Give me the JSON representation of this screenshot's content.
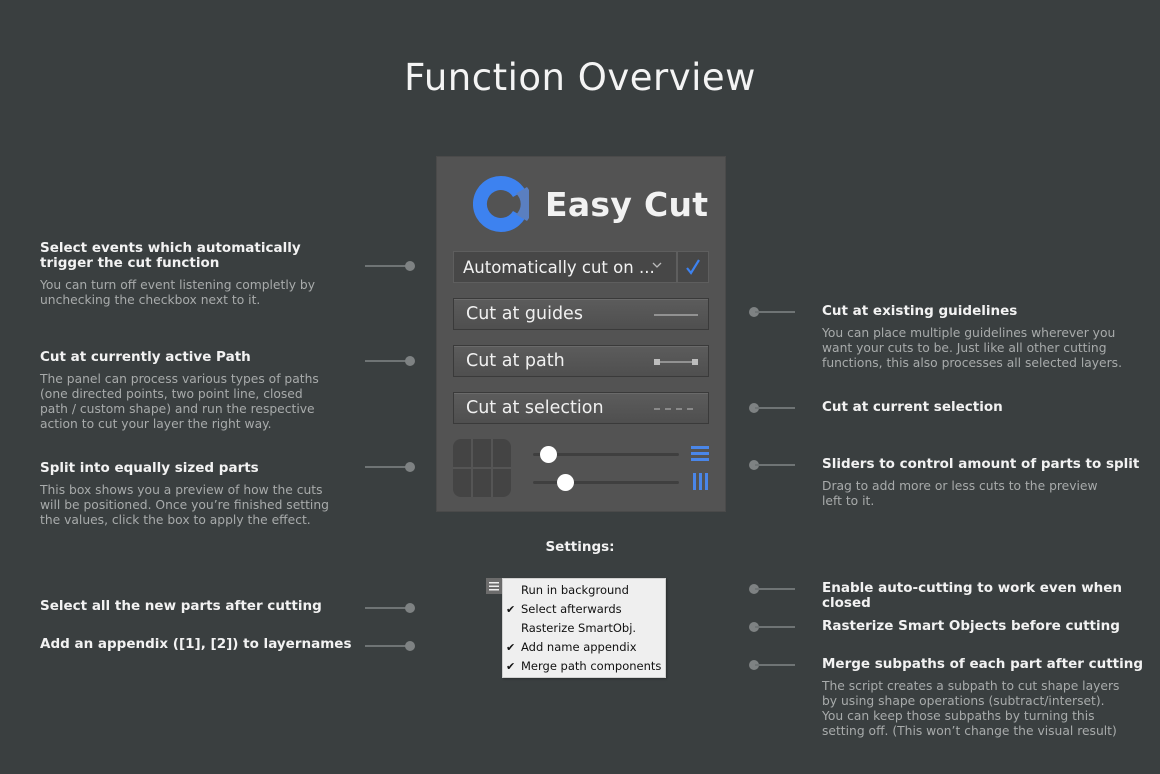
{
  "page": {
    "title": "Function Overview",
    "background": "#3a3f40"
  },
  "panel": {
    "app_name": "Easy Cut",
    "accent_color": "#3d82f0",
    "logo_icon": "c-logo-icon",
    "dropdown": {
      "value": "Automatically cut on ...",
      "icon": "chevron-down-icon"
    },
    "auto_cut_enabled": true,
    "buttons": [
      {
        "label": "Cut at guides",
        "icon": "guide-line-icon"
      },
      {
        "label": "Cut at path",
        "icon": "path-line-icon"
      },
      {
        "label": "Cut at selection",
        "icon": "dashed-line-icon"
      }
    ],
    "preview": {
      "rows": 2,
      "columns": 3
    },
    "sliders": [
      {
        "name": "rows",
        "value_fraction": 0.1,
        "icon": "horizontal-lines-icon"
      },
      {
        "name": "columns",
        "value_fraction": 0.22,
        "icon": "vertical-lines-icon"
      }
    ]
  },
  "settings": {
    "label": "Settings:",
    "menu_icon": "hamburger-menu-icon",
    "items": [
      {
        "label": "Run in background",
        "checked": false
      },
      {
        "label": "Select afterwards",
        "checked": true
      },
      {
        "label": "Rasterize SmartObj.",
        "checked": false
      },
      {
        "label": "Add name appendix",
        "checked": true
      },
      {
        "label": "Merge path components",
        "checked": true
      }
    ]
  },
  "callouts_left": [
    {
      "heading": "Select events which automatically\ntrigger the cut function",
      "description": "You can turn off event listening completly by\nunchecking the checkbox next to it."
    },
    {
      "heading": "Cut at currently active Path",
      "description": "The panel can process various types of paths\n(one directed points, two point line, closed\npath / custom shape) and run the respective\naction to cut your layer the right way."
    },
    {
      "heading": "Split into equally sized parts",
      "description": "This box shows you a preview of how the cuts\nwill be positioned. Once you’re finished setting\nthe values, click the box to apply the effect."
    },
    {
      "heading": "Select all the new parts after cutting",
      "description": ""
    },
    {
      "heading": "Add an appendix ([1], [2]) to layernames",
      "description": ""
    }
  ],
  "callouts_right": [
    {
      "heading": "Cut at existing guidelines",
      "description": "You can place multiple guidelines wherever you\nwant your cuts to be. Just like all other cutting\nfunctions, this also processes all selected layers."
    },
    {
      "heading": "Cut at current selection",
      "description": ""
    },
    {
      "heading": "Sliders to control amount of parts to split",
      "description": "Drag to add more or less cuts to the preview\nleft to it."
    },
    {
      "heading": "Enable auto-cutting to work even when closed",
      "description": ""
    },
    {
      "heading": "Rasterize Smart Objects before cutting",
      "description": ""
    },
    {
      "heading": "Merge subpaths of each part after cutting",
      "description": "The script creates a subpath to cut shape layers\nby using shape operations  (subtract/interset).\nYou can keep those subpaths by turning this\nsetting off. (This won’t change the visual result)"
    }
  ]
}
